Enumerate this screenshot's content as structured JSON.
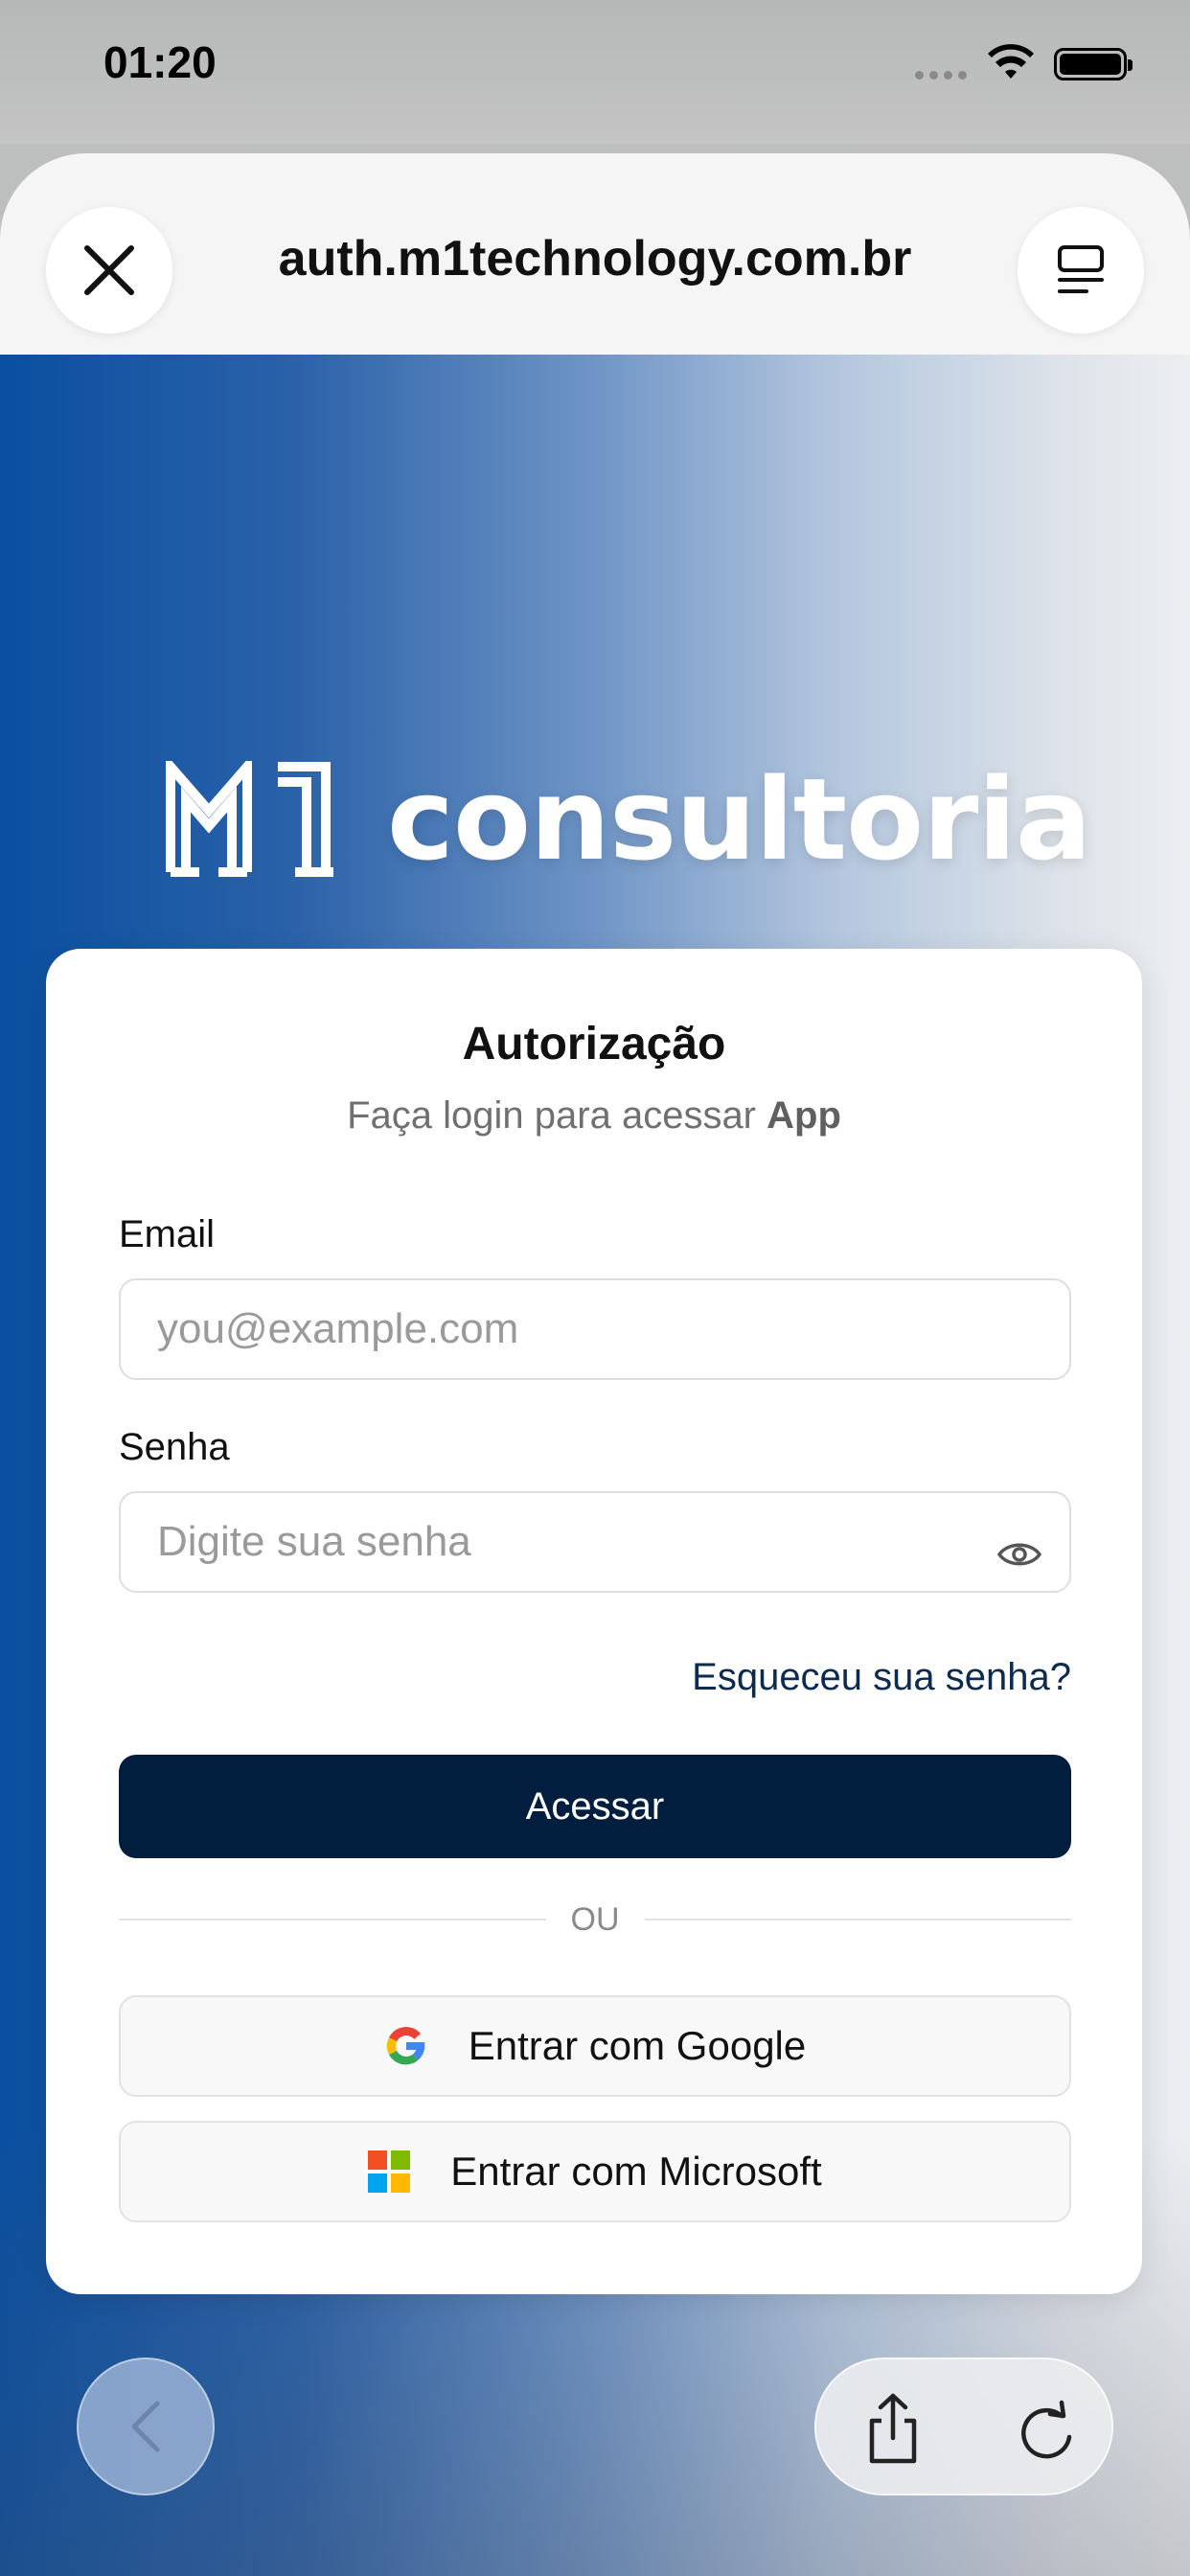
{
  "status_bar": {
    "time": "01:20",
    "icons": [
      "cellular-dots-icon",
      "wifi-icon",
      "battery-icon"
    ]
  },
  "browser": {
    "url": "auth.m1technology.com.br",
    "close_icon": "close-icon",
    "reader_icon": "reader-mode-icon"
  },
  "logo": {
    "mark": "M1",
    "word": "consultoria"
  },
  "card": {
    "title": "Autorização",
    "subtitle_prefix": "Faça login para acessar ",
    "subtitle_app": "App",
    "email_label": "Email",
    "email_placeholder": "you@example.com",
    "password_label": "Senha",
    "password_placeholder": "Digite sua senha",
    "forgot_link": "Esqueceu sua senha?",
    "submit_label": "Acessar",
    "divider_label": "OU",
    "google_label": "Entrar com Google",
    "microsoft_label": "Entrar com Microsoft"
  },
  "toolbar": {
    "back_icon": "chevron-left-icon",
    "share_icon": "share-icon",
    "reload_icon": "reload-icon"
  },
  "colors": {
    "primary": "#021e3e",
    "gradient_left": "#0a4fa0",
    "gradient_right": "#eceef0",
    "link": "#0d2a4f"
  }
}
